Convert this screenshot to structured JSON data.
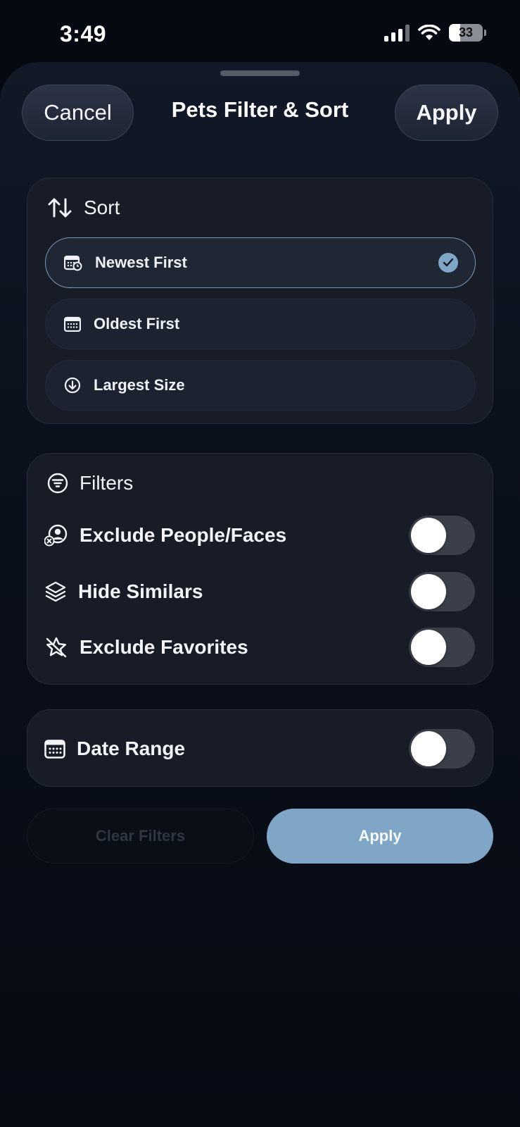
{
  "status_bar": {
    "time": "3:49",
    "battery_level": "33",
    "battery_fraction": 0.33
  },
  "header": {
    "cancel_label": "Cancel",
    "title": "Pets Filter & Sort",
    "apply_label": "Apply"
  },
  "sort": {
    "title": "Sort",
    "icon": "sort-arrows-icon",
    "options": [
      {
        "label": "Newest First",
        "icon": "calendar-clock-icon",
        "selected": true
      },
      {
        "label": "Oldest First",
        "icon": "calendar-icon",
        "selected": false
      },
      {
        "label": "Largest Size",
        "icon": "arrow-down-circle-icon",
        "selected": false
      }
    ]
  },
  "filters": {
    "title": "Filters",
    "icon": "filter-circle-icon",
    "items": [
      {
        "label": "Exclude People/Faces",
        "icon": "person-x-icon",
        "enabled": false
      },
      {
        "label": "Hide Similars",
        "icon": "layers-icon",
        "enabled": false
      },
      {
        "label": "Exclude Favorites",
        "icon": "star-slash-icon",
        "enabled": false
      }
    ]
  },
  "date_range": {
    "label": "Date Range",
    "icon": "calendar-icon",
    "enabled": false
  },
  "footer": {
    "clear_label": "Clear Filters",
    "apply_label": "Apply"
  },
  "colors": {
    "accent": "#7fa6c7",
    "background": "#050912",
    "card": "#171c27"
  }
}
